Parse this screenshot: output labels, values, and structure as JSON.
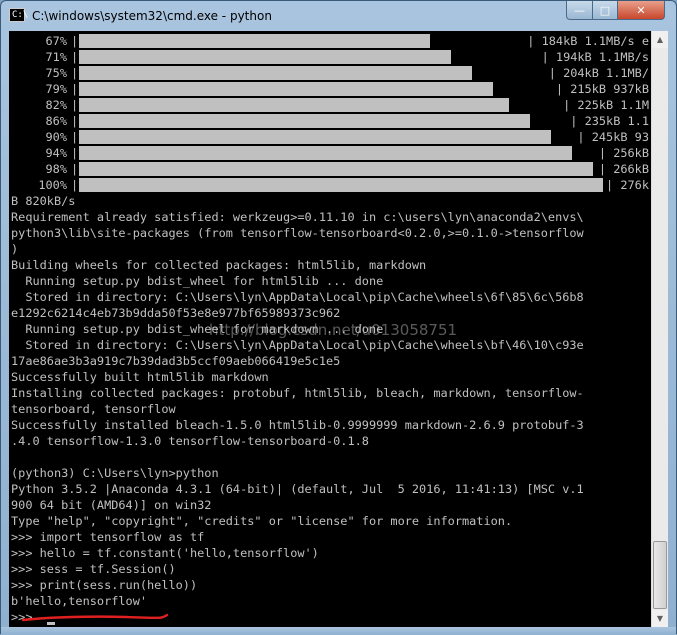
{
  "window": {
    "title": "C:\\windows\\system32\\cmd.exe - python",
    "icon_text": "C:\\",
    "minimize_glyph": "—",
    "maximize_glyph": "□",
    "close_glyph": "✕"
  },
  "progress_rows": [
    {
      "pct": "67%",
      "tail": "| 184kB 1.1MB/s e",
      "fill": 0.67
    },
    {
      "pct": "71%",
      "tail": "| 194kB 1.1MB/s",
      "fill": 0.71
    },
    {
      "pct": "75%",
      "tail": "| 204kB 1.1MB/",
      "fill": 0.75
    },
    {
      "pct": "79%",
      "tail": "| 215kB 937kB",
      "fill": 0.79
    },
    {
      "pct": "82%",
      "tail": "| 225kB 1.1M",
      "fill": 0.82
    },
    {
      "pct": "86%",
      "tail": "| 235kB 1.1",
      "fill": 0.86
    },
    {
      "pct": "90%",
      "tail": "| 245kB 93",
      "fill": 0.9
    },
    {
      "pct": "94%",
      "tail": "| 256kB",
      "fill": 0.94
    },
    {
      "pct": "98%",
      "tail": "| 266kB",
      "fill": 0.98
    },
    {
      "pct": "100%",
      "tail": "| 276k",
      "fill": 1.0
    }
  ],
  "console_lines": [
    "B 820kB/s",
    "Requirement already satisfied: werkzeug>=0.11.10 in c:\\users\\lyn\\anaconda2\\envs\\",
    "python3\\lib\\site-packages (from tensorflow-tensorboard<0.2.0,>=0.1.0->tensorflow",
    ")",
    "Building wheels for collected packages: html5lib, markdown",
    "  Running setup.py bdist_wheel for html5lib ... done",
    "  Stored in directory: C:\\Users\\lyn\\AppData\\Local\\pip\\Cache\\wheels\\6f\\85\\6c\\56b8",
    "e1292c6214c4eb73b9dda50f53e8e977bf65989373c962",
    "  Running setup.py bdist_wheel for markdown ... done",
    "  Stored in directory: C:\\Users\\lyn\\AppData\\Local\\pip\\Cache\\wheels\\bf\\46\\10\\c93e",
    "17ae86ae3b3a919c7b39dad3b5ccf09aeb066419e5c1e5",
    "Successfully built html5lib markdown",
    "Installing collected packages: protobuf, html5lib, bleach, markdown, tensorflow-",
    "tensorboard, tensorflow",
    "Successfully installed bleach-1.5.0 html5lib-0.9999999 markdown-2.6.9 protobuf-3",
    ".4.0 tensorflow-1.3.0 tensorflow-tensorboard-0.1.8",
    "",
    "(python3) C:\\Users\\lyn>python",
    "Python 3.5.2 |Anaconda 4.3.1 (64-bit)| (default, Jul  5 2016, 11:41:13) [MSC v.1",
    "900 64 bit (AMD64)] on win32",
    "Type \"help\", \"copyright\", \"credits\" or \"license\" for more information.",
    ">>> import tensorflow as tf",
    ">>> hello = tf.constant('hello,tensorflow')",
    ">>> sess = tf.Session()",
    ">>> print(sess.run(hello))",
    "b'hello,tensorflow'",
    ">>> "
  ],
  "watermark": "http://blog.csdn.net/u013058751",
  "colors": {
    "console_bg": "#000000",
    "console_fg": "#c0c0c0",
    "annotation": "#e02020"
  }
}
